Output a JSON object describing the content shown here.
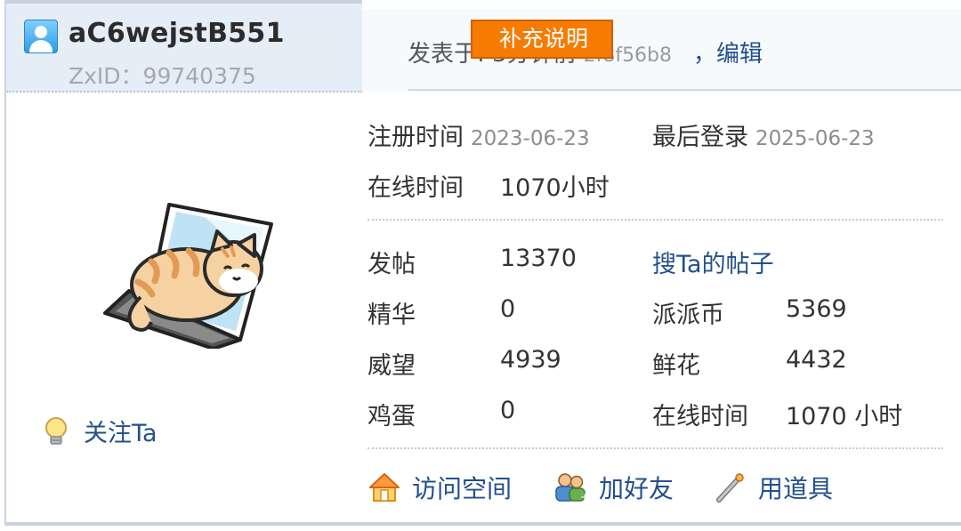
{
  "user": {
    "name": "aC6wejstB551",
    "zxid": "ZxID：99740375",
    "follow_label": "关注Ta"
  },
  "post": {
    "posted_label": "发表于: 3分钟前",
    "hash": "2f8f56b8",
    "edit_label": "，编辑",
    "supplement_label": "补充说明"
  },
  "profile": {
    "register_label": "注册时间",
    "register_date": "2023-06-23",
    "last_login_label": "最后登录",
    "last_login_date": "2025-06-23",
    "online_label": "在线时间",
    "online_value": "1070小时"
  },
  "stats": {
    "posts_label": "发帖",
    "posts_value": "13370",
    "search_posts_link": "搜Ta的帖子",
    "digest_label": "精华",
    "digest_value": "0",
    "coins_label": "派派币",
    "coins_value": "5369",
    "prestige_label": "威望",
    "prestige_value": "4939",
    "flowers_label": "鲜花",
    "flowers_value": "4432",
    "eggs_label": "鸡蛋",
    "eggs_value": "0",
    "online_label": "在线时间",
    "online_value": "1070 小时"
  },
  "actions": {
    "visit_space": "访问空间",
    "add_friend": "加好友",
    "use_item": "用道具"
  },
  "colors": {
    "link": "#23508a",
    "accent": "#f57c00",
    "header_bg": "#e5edf7"
  },
  "icons": [
    "user-icon",
    "bulb-icon",
    "home-icon",
    "friends-icon",
    "wand-icon"
  ]
}
